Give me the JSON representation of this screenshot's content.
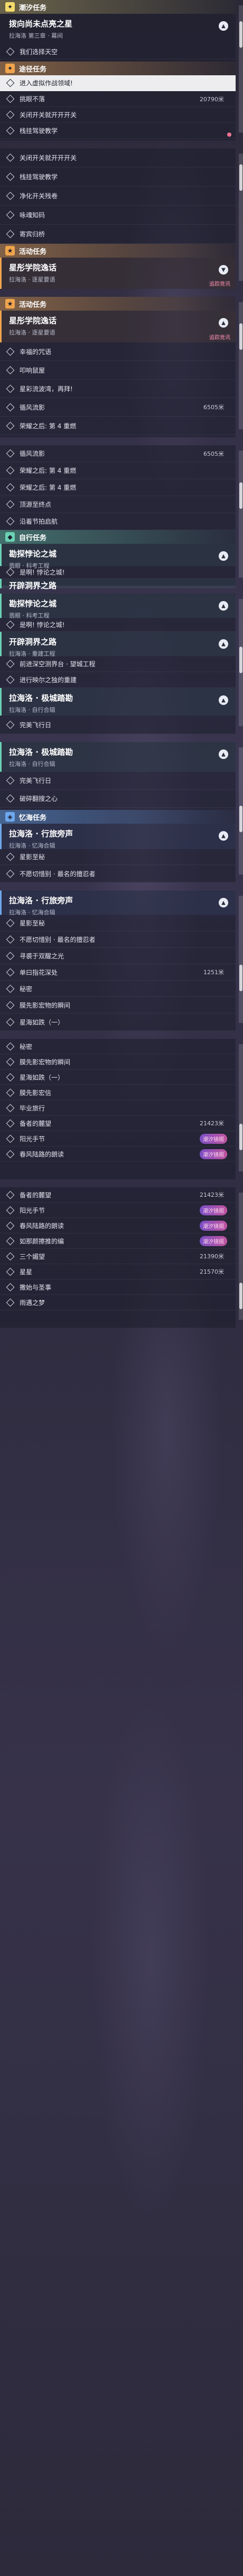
{
  "sections": {
    "tide": "潮汐任务",
    "passing": "途径任务",
    "activity": "活动任务",
    "self": "自行任务",
    "inherit": "忆海任务"
  },
  "tracking": "追踪竞讯",
  "mark_tide": "潮汐镜阁",
  "p1": {
    "q1": {
      "title": "拨向尚未点亮之星",
      "sub": "拉海洛 第三章 · 幕间"
    },
    "q1_obj1": "我们选择天空",
    "q2_obj1": "进入虚拟作战领域!",
    "q2_obj2": "挑眼不落",
    "q2_obj2_dist": "20790米",
    "q2_obj3": "关闭开关就开开开关",
    "q2_obj4": "栈挂驾驶教学"
  },
  "p2": {
    "o1": "关闭开关就开开开关",
    "o2": "栈挂驾驶教学",
    "o3": "净化开关残卷",
    "o4": "咏魂知码",
    "o5": "寄宾归桥",
    "q_title": "星彤学院逸话",
    "q_sub": "拉海洛 · 逐星要语"
  },
  "p3": {
    "q_title": "星彤学院逸话",
    "q_sub": "拉海洛 · 逐星要语",
    "o1": "幸福的咒语",
    "o2": "叩响鼠屋",
    "o3": "星彩流波湾，再拜!",
    "o4": "循风流影",
    "o4_dist": "6505米",
    "o5": "荣耀之后: 第 4 重燃"
  },
  "p4": {
    "o1": "循风流影",
    "o1_dist": "6505米",
    "o2": "荣耀之后: 第 4 重燃",
    "o3": "荣耀之后: 第 4 重燃",
    "o4": "顶源至终点",
    "o5": "沿着节拍启航",
    "q_title": "勘探悖论之城",
    "q_sub": "翡眼 · 科考工程",
    "o6": "是啊! 悖论之城!",
    "q2_title": "开辟洞界之路"
  },
  "p5": {
    "q1_title": "勘探悖论之城",
    "q1_sub": "翡眼 · 科考工程",
    "q1_o1": "是啊! 悖论之城!",
    "q2_title": "开辟洞界之路",
    "q2_sub": "拉海洛 · 重建工程",
    "q2_o1": "前进深空测界台 · 望城工程",
    "q2_o2": "进行映尔之独的重建",
    "q3_title": "拉海洛 · 极城踏勘",
    "q3_sub": "拉海洛 · 自行合辑",
    "q3_o1": "完美飞行日"
  },
  "p6": {
    "q1_title": "拉海洛 · 极城踏勘",
    "q1_sub": "拉海洛 · 自行合辑",
    "q1_o1": "完美飞行日",
    "q1_o2": "破碎翻搜之心",
    "q2_title": "拉海洛 · 行旅旁声",
    "q2_sub": "拉海洛 · 忆海合辑",
    "q2_o1": "星影至秘",
    "q2_o2": "不愿切惜别 · 最名的擅忍者"
  },
  "p7": {
    "q_title": "拉海洛 · 行旅旁声",
    "q_sub": "拉海洛 · 忆海合辑",
    "o1": "星影至秘",
    "o2": "不愿切惜别 · 最名的擅忍者",
    "o3": "寻裘于双醒之光",
    "o4": "单曰指花深处",
    "o4_dist": "1251米",
    "o5": "秘密",
    "o6": "膜先影宏物的瞬间",
    "o7": "星海如跌（一）"
  },
  "p8": {
    "o1": "秘密",
    "o2": "膜先影宏物的瞬间",
    "o3": "星海如跌（一）",
    "o4": "膜先影宏信",
    "o5": "毕业旅行",
    "o6": "备者的麓望",
    "o6_dist": "21423米",
    "o7": "阳光手节",
    "o8": "春风陆路的朗读"
  },
  "p9": {
    "o1": "备者的麓望",
    "o1_dist": "21423米",
    "o2": "阳光手节",
    "o3": "春风陆路的朗读",
    "o4": "如那颜擦推的编",
    "o5": "三个媚望",
    "o5_dist": "21390米",
    "o6": "星星",
    "o6_dist": "21570米",
    "o7": "撒始与圣事",
    "o8": "雨遇之梦"
  }
}
